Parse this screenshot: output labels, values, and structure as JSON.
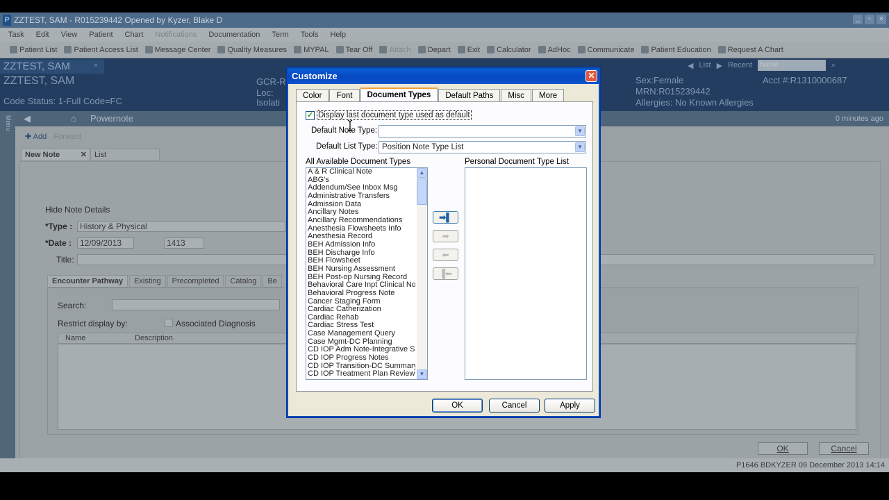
{
  "app": {
    "title": "ZZTEST, SAM - R015239442 Opened by Kyzer, Blake D",
    "menu": [
      "Task",
      "Edit",
      "View",
      "Patient",
      "Chart",
      "Notifications",
      "Documentation",
      "Term",
      "Tools",
      "Help"
    ],
    "toolbar": [
      "Patient List",
      "Patient Access List",
      "Message Center",
      "Quality Measures",
      "MYPAL",
      "Tear Off",
      "Attach",
      "Depart",
      "Exit",
      "Calculator",
      "AdHoc",
      "Communicate",
      "Patient Education",
      "Request A Chart"
    ]
  },
  "banner": {
    "patient_tab": "ZZTEST, SAM",
    "name": "ZZTEST, SAM",
    "code_status": "Code Status: 1-Full Code=FC",
    "gcr": "GCR-R",
    "loc": "Loc:",
    "isolation": "Isolati",
    "sex": "Sex:Female",
    "mrn": "MRN:R015239442",
    "allergies": "Allergies:  No Known Allergies",
    "acct": "Acct #:R1310000687",
    "nav_list": "List",
    "nav_recent": "Recent",
    "search_placeholder": "Name"
  },
  "powernote": {
    "title": "Powernote",
    "updated": "0 minutes ago",
    "add_label": "Add",
    "forward_label": "Forward",
    "tab_new_note": "New Note",
    "tab_list": "List",
    "hide_details": "Hide Note Details",
    "type_label": "*Type :",
    "type_value": "History & Physical",
    "date_label": "*Date :",
    "date_value": "12/09/2013",
    "time_value": "1413",
    "title_label": "Title:",
    "subtabs": [
      "Encounter Pathway",
      "Existing",
      "Precompleted",
      "Catalog",
      "Be"
    ],
    "search_label": "Search:",
    "restrict_label": "Restrict display by:",
    "assoc_dx": "Associated Diagnosis",
    "col_name": "Name",
    "col_desc": "Description",
    "ok": "OK",
    "cancel": "Cancel"
  },
  "status": {
    "right": "P1646  BDKYZER  09 December 2013  14:14"
  },
  "dialog": {
    "title": "Customize",
    "tabs": [
      "Color",
      "Font",
      "Document Types",
      "Default Paths",
      "Misc",
      "More"
    ],
    "active_tab": "Document Types",
    "checkbox_label": "Display last document type used as default",
    "checkbox_checked": true,
    "default_note_type_label": "Default Note Type:",
    "default_note_type_value": "",
    "default_list_type_label": "Default List Type:",
    "default_list_type_value": "Position Note Type List",
    "all_types_label": "All Available Document Types",
    "personal_list_label": "Personal Document Type List",
    "document_types": [
      "A & R Clinical Note",
      "ABG's",
      "Addendum/See Inbox Msg",
      "Administrative Transfers",
      "Admission Data",
      "Ancillary Notes",
      "Ancillary Recommendations",
      "Anesthesia Flowsheets Info",
      "Anesthesia Record",
      "BEH Admission Info",
      "BEH Discharge Info",
      "BEH Flowsheet",
      "BEH Nursing Assessment",
      "BEH Post-op Nursing Record",
      "Behavioral Care Inpt Clinical Note",
      "Behavioral Progress Note",
      "Cancer Staging Form",
      "Cardiac Catherization",
      "Cardiac Rehab",
      "Cardiac Stress Test",
      "Case Management Query",
      "Case Mgmt-DC Planning",
      "CD IOP Adm Note-Integrative Su",
      "CD IOP Progress Notes",
      "CD IOP Transition-DC Summary",
      "CD IOP Treatment Plan Review"
    ],
    "personal_types": [],
    "buttons": {
      "ok": "OK",
      "cancel": "Cancel",
      "apply": "Apply"
    }
  }
}
